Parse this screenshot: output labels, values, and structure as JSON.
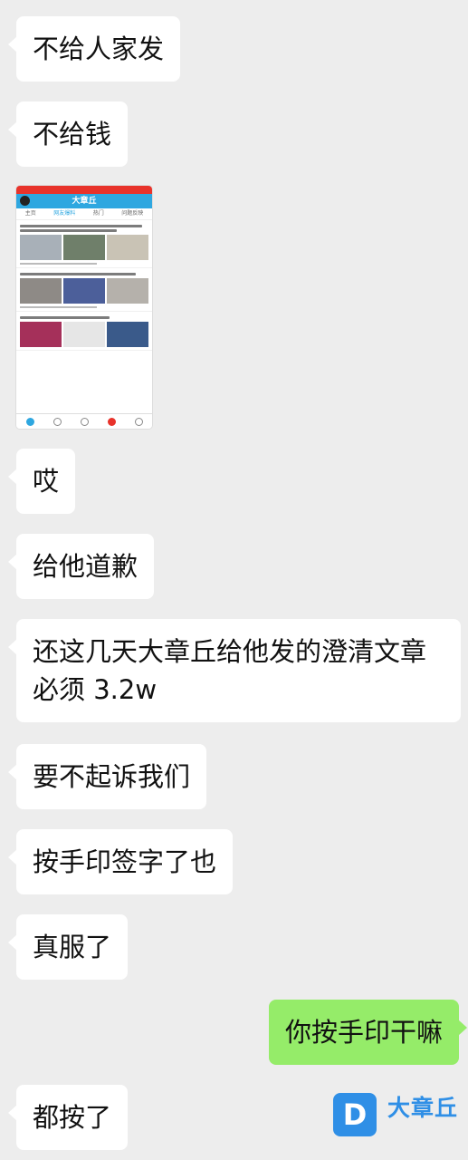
{
  "messages": [
    {
      "side": "left",
      "text": "不给人家发"
    },
    {
      "side": "left",
      "text": "不给钱"
    },
    {
      "side": "left",
      "type": "image",
      "image": {
        "app_title": "大章丘",
        "tabs": [
          "主页",
          "网友爆料",
          "热门",
          "问题反映"
        ]
      }
    },
    {
      "side": "left",
      "text": "哎"
    },
    {
      "side": "left",
      "text": "给他道歉"
    },
    {
      "side": "left",
      "text": "还这几天大章丘给他发的澄清文章必须 3.2w",
      "line1": "还这几天大章丘给他发的澄清文章",
      "line2": "必须 3.2w"
    },
    {
      "side": "left",
      "text": "要不起诉我们"
    },
    {
      "side": "left",
      "text": "按手印签字了也"
    },
    {
      "side": "left",
      "text": "真服了"
    },
    {
      "side": "right",
      "text": "你按手印干嘛"
    },
    {
      "side": "left",
      "text": "都按了"
    }
  ],
  "watermark": {
    "logo_letter": "D",
    "brand": "大章丘"
  },
  "colors": {
    "background": "#ededed",
    "left_bubble": "#ffffff",
    "right_bubble": "#95ec69",
    "app_accent": "#2ea7e0"
  }
}
